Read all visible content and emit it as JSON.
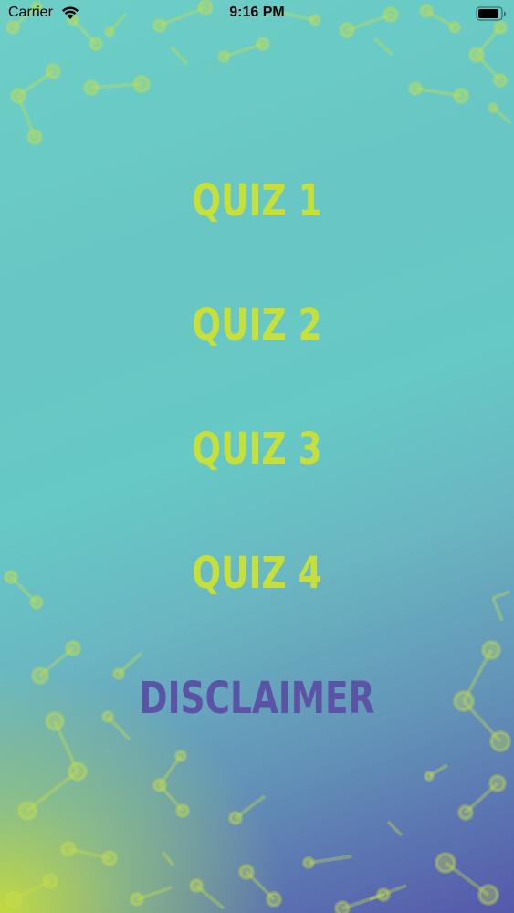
{
  "status_bar": {
    "carrier": "Carrier",
    "time": "9:16 PM",
    "wifi_icon": "wifi-icon",
    "battery_icon": "battery-icon"
  },
  "menu": {
    "items": [
      {
        "label": "QUIZ 1"
      },
      {
        "label": "QUIZ 2"
      },
      {
        "label": "QUIZ 3"
      },
      {
        "label": "QUIZ 4"
      }
    ],
    "disclaimer": "DISCLAIMER"
  },
  "colors": {
    "quiz_text": "#c7df3a",
    "disclaimer_text": "#5a53a6",
    "gradient_top_right": "#5558aa",
    "gradient_middle": "#66c9c5",
    "gradient_bottom_left": "#c8de3a",
    "molecule_tint": "#c9e04a"
  }
}
